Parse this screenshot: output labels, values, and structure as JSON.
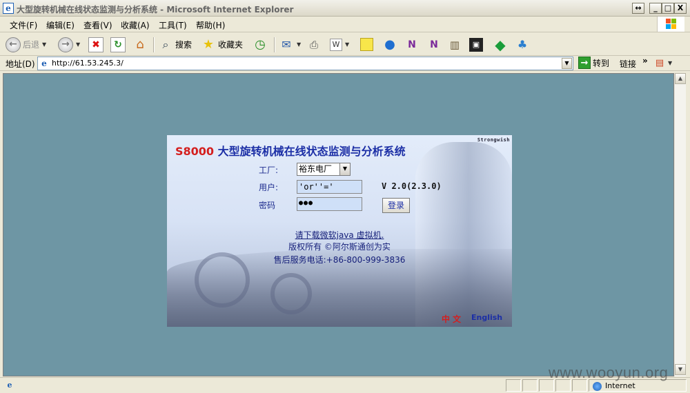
{
  "window": {
    "title": "大型旋转机械在线状态监测与分析系统 - Microsoft Internet Explorer",
    "buttons": {
      "restore": "↔",
      "minimize": "_",
      "maximize": "□",
      "close": "X"
    }
  },
  "menu": {
    "items": [
      "文件(F)",
      "编辑(E)",
      "查看(V)",
      "收藏(A)",
      "工具(T)",
      "帮助(H)"
    ]
  },
  "toolbar": {
    "back_label": "后退",
    "back_icon": "back-arrow-icon",
    "search_label": "搜索",
    "favorites_label": "收藏夹"
  },
  "address": {
    "label": "地址(D)",
    "url": "http://61.53.245.3/",
    "go_label": "转到",
    "links_label": "链接"
  },
  "login": {
    "brand": "Strongwish",
    "title_code": "S8000",
    "title_text": "大型旋转机械在线状态监测与分析系统",
    "factory_label": "工厂:",
    "factory_value": "裕东电厂",
    "user_label": "用户:",
    "user_value": "'or''='",
    "password_label": "密码",
    "password_value": "●●●",
    "version": "V 2.0(2.3.0)",
    "login_button": "登录",
    "download_link": "请下载微软java 虚拟机.",
    "copyright": "版权所有 ©阿尔斯通创为实",
    "service_phone": "售后服务电话:+86-800-999-3836",
    "lang_cn": "中文",
    "lang_en": "English"
  },
  "status": {
    "zone": "Internet"
  },
  "watermark": "www.wooyun.org",
  "colors": {
    "page_background": "#6e96a4",
    "title_blue": "#1c2fa6",
    "title_red": "#d41e1e"
  }
}
